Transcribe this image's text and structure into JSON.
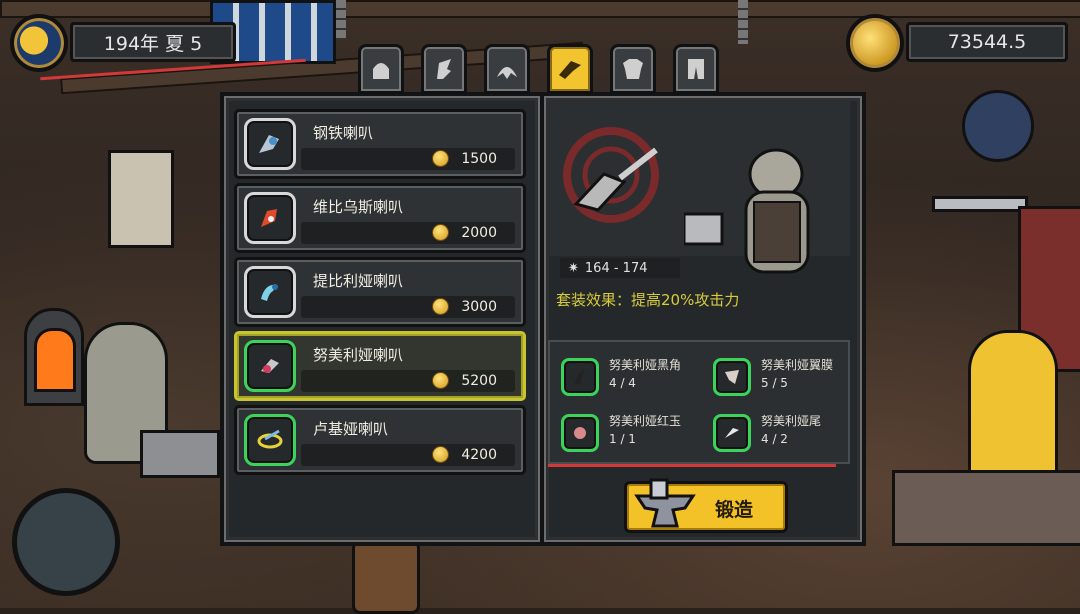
{
  "hud": {
    "date": "194年 夏 5",
    "gold": "73544.5",
    "date_icon": "moon-sun-icon",
    "gold_icon": "gold-coin-icon"
  },
  "tabs": [
    {
      "icon": "helmet-icon",
      "active": false
    },
    {
      "icon": "shoulder-armor-icon",
      "active": false
    },
    {
      "icon": "claw-icon",
      "active": false
    },
    {
      "icon": "horn-icon",
      "active": true
    },
    {
      "icon": "chestplate-icon",
      "active": false
    },
    {
      "icon": "leg-armor-icon",
      "active": false
    }
  ],
  "items": [
    {
      "name": "钢铁喇叭",
      "price": "1500"
    },
    {
      "name": "维比乌斯喇叭",
      "price": "2000"
    },
    {
      "name": "提比利娅喇叭",
      "price": "3000"
    },
    {
      "name": "努美利娅喇叭",
      "price": "5200"
    },
    {
      "name": "卢基娅喇叭",
      "price": "4200"
    }
  ],
  "detail": {
    "damage": "164 - 174",
    "set_effect": "套装效果：提高20%攻击力"
  },
  "materials": [
    {
      "name": "努美利娅黑角",
      "count": "4  / 4"
    },
    {
      "name": "努美利娅翼膜",
      "count": "5  / 5"
    },
    {
      "name": "努美利娅红玉",
      "count": "1  / 1"
    },
    {
      "name": "努美利娅尾",
      "count": "4  / 2"
    }
  ],
  "forge_button": "锻造",
  "colors": {
    "accent_yellow": "#f3c228",
    "selected_border": "#c8c62c",
    "rarity_green": "#3cd35a",
    "set_effect_text": "#d8cc3a",
    "warning_red": "#d23a3a"
  }
}
